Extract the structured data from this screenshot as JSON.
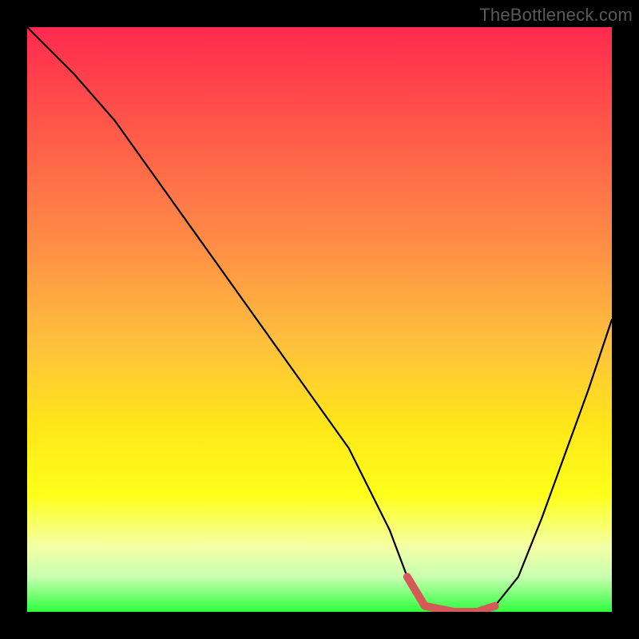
{
  "watermark": "TheBottleneck.com",
  "chart_data": {
    "type": "line",
    "title": "",
    "xlabel": "",
    "ylabel": "",
    "xlim": [
      0,
      100
    ],
    "ylim": [
      0,
      100
    ],
    "series": [
      {
        "name": "curve",
        "x": [
          0,
          3,
          8,
          15,
          25,
          35,
          45,
          55,
          62,
          65,
          68,
          73,
          77,
          80,
          84,
          88,
          92,
          96,
          100
        ],
        "y": [
          100,
          97,
          92,
          84,
          70,
          56,
          42,
          28,
          14,
          6,
          1,
          0,
          0,
          1,
          6,
          16,
          27,
          38,
          50
        ]
      },
      {
        "name": "highlight",
        "x": [
          65,
          68,
          73,
          77,
          80
        ],
        "y": [
          6,
          1,
          0,
          0,
          1
        ]
      }
    ],
    "gradient_stops": [
      {
        "pos": 0,
        "color": "#ff2a4e"
      },
      {
        "pos": 18,
        "color": "#ff5a4a"
      },
      {
        "pos": 36,
        "color": "#ff8a46"
      },
      {
        "pos": 54,
        "color": "#ffc03d"
      },
      {
        "pos": 68,
        "color": "#ffe61a"
      },
      {
        "pos": 80,
        "color": "#feff1a"
      },
      {
        "pos": 89,
        "color": "#f3ffa8"
      },
      {
        "pos": 94,
        "color": "#c8ffb0"
      },
      {
        "pos": 100,
        "color": "#2fff3f"
      }
    ]
  }
}
